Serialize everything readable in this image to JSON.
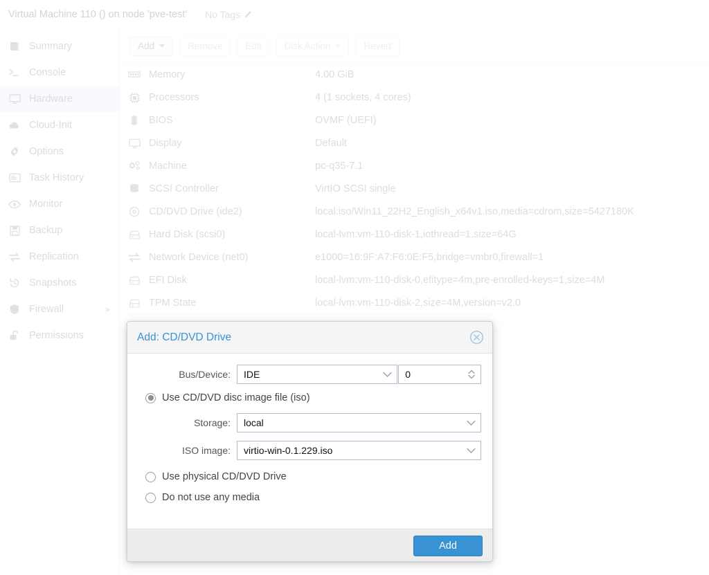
{
  "header": {
    "title": "Virtual Machine 110 () on node 'pve-test'",
    "tags_label": "No Tags",
    "edit_tags_icon": "pencil-icon"
  },
  "sidebar": {
    "items": [
      {
        "label": "Summary",
        "icon": "book-icon",
        "selected": false,
        "expandable": false
      },
      {
        "label": "Console",
        "icon": "terminal-icon",
        "selected": false,
        "expandable": false
      },
      {
        "label": "Hardware",
        "icon": "monitor-icon",
        "selected": true,
        "expandable": false
      },
      {
        "label": "Cloud-Init",
        "icon": "cloud-icon",
        "selected": false,
        "expandable": false
      },
      {
        "label": "Options",
        "icon": "gear-icon",
        "selected": false,
        "expandable": false
      },
      {
        "label": "Task History",
        "icon": "list-icon",
        "selected": false,
        "expandable": false
      },
      {
        "label": "Monitor",
        "icon": "eye-icon",
        "selected": false,
        "expandable": false
      },
      {
        "label": "Backup",
        "icon": "floppy-icon",
        "selected": false,
        "expandable": false
      },
      {
        "label": "Replication",
        "icon": "sync-icon",
        "selected": false,
        "expandable": false
      },
      {
        "label": "Snapshots",
        "icon": "history-icon",
        "selected": false,
        "expandable": false
      },
      {
        "label": "Firewall",
        "icon": "shield-icon",
        "selected": false,
        "expandable": true
      },
      {
        "label": "Permissions",
        "icon": "unlock-icon",
        "selected": false,
        "expandable": false
      }
    ]
  },
  "toolbar": {
    "buttons": [
      {
        "label": "Add",
        "dropdown": true,
        "disabled": false
      },
      {
        "label": "Remove",
        "dropdown": false,
        "disabled": true
      },
      {
        "label": "Edit",
        "dropdown": false,
        "disabled": true
      },
      {
        "label": "Disk Action",
        "dropdown": true,
        "disabled": true
      },
      {
        "label": "Revert",
        "dropdown": false,
        "disabled": true
      }
    ]
  },
  "hardware": {
    "rows": [
      {
        "icon": "memory-icon",
        "key": "Memory",
        "value": "4.00 GiB"
      },
      {
        "icon": "cpu-icon",
        "key": "Processors",
        "value": "4 (1 sockets, 4 cores)"
      },
      {
        "icon": "chip-icon",
        "key": "BIOS",
        "value": "OVMF (UEFI)"
      },
      {
        "icon": "display-icon",
        "key": "Display",
        "value": "Default"
      },
      {
        "icon": "gears-icon",
        "key": "Machine",
        "value": "pc-q35-7.1"
      },
      {
        "icon": "database-icon",
        "key": "SCSI Controller",
        "value": "VirtIO SCSI single"
      },
      {
        "icon": "cd-icon",
        "key": "CD/DVD Drive (ide2)",
        "value": "local:iso/Win11_22H2_English_x64v1.iso,media=cdrom,size=5427180K"
      },
      {
        "icon": "harddisk-icon",
        "key": "Hard Disk (scsi0)",
        "value": "local-lvm:vm-110-disk-1,iothread=1,size=64G"
      },
      {
        "icon": "network-icon",
        "key": "Network Device (net0)",
        "value": "e1000=16:9F:A7:F6:0E:F5,bridge=vmbr0,firewall=1"
      },
      {
        "icon": "harddisk-icon",
        "key": "EFI Disk",
        "value": "local-lvm:vm-110-disk-0,efitype=4m,pre-enrolled-keys=1,size=4M"
      },
      {
        "icon": "harddisk-icon",
        "key": "TPM State",
        "value": "local-lvm:vm-110-disk-2,size=4M,version=v2.0"
      }
    ]
  },
  "dialog": {
    "title": "Add: CD/DVD Drive",
    "close_icon": "close-circle-icon",
    "bus_device": {
      "label": "Bus/Device:",
      "bus_value": "IDE",
      "device_value": "0"
    },
    "options": [
      {
        "label": "Use CD/DVD disc image file (iso)",
        "selected": true
      },
      {
        "label": "Use physical CD/DVD Drive",
        "selected": false
      },
      {
        "label": "Do not use any media",
        "selected": false
      }
    ],
    "storage": {
      "label": "Storage:",
      "value": "local"
    },
    "iso": {
      "label": "ISO image:",
      "value": "virtio-win-0.1.229.iso"
    },
    "submit_label": "Add",
    "accent_color": "#3892d4"
  }
}
